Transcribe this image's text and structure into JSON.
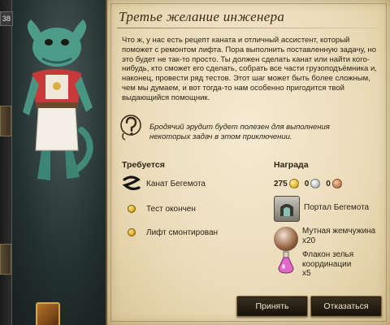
{
  "scene": {
    "counter": "38"
  },
  "quest": {
    "title": "Третье желание инженера",
    "description": "Что ж, у нас есть рецепт каната и отличный ассистент, который поможет с ремонтом лифта. Пора выполнить поставленную задачу, но это будет не так-то просто. Ты должен сделать канат или найти кого-нибудь, кто сможет его сделать, собрать все части грузоподъёмника и, наконец, провести ряд тестов. Этот шаг может быть более сложным, чем мы думаем, и вот тогда-то нам особенно пригодится твой выдающийся помощник.",
    "hint": "Бродячий эрудит будет полезен для выполнения некоторых задач в этом приключении."
  },
  "requirements": {
    "heading": "Требуется",
    "items": [
      {
        "label": "Канат Бегемота",
        "icon": "rope-icon"
      },
      {
        "label": "Тест окончен",
        "icon": "gold-dot-icon"
      },
      {
        "label": "Лифт смонтирован",
        "icon": "gold-dot-icon"
      }
    ]
  },
  "rewards": {
    "heading": "Награда",
    "coins": {
      "gold": "275",
      "silver": "0",
      "copper": "0"
    },
    "items": [
      {
        "name": "Портал Бегемота",
        "qty": "",
        "icon": "portal-icon"
      },
      {
        "name": "Мутная жемчужина",
        "qty": "x20",
        "icon": "pearl-icon"
      },
      {
        "name": "Флакон зелья координации",
        "qty": "x5",
        "icon": "potion-icon"
      }
    ]
  },
  "buttons": {
    "accept": "Принять",
    "decline": "Отказаться"
  },
  "colors": {
    "parchment": "#eadbb8",
    "ink": "#2e2316",
    "button_bg": "#1e180f",
    "button_text": "#f1e4c6"
  }
}
